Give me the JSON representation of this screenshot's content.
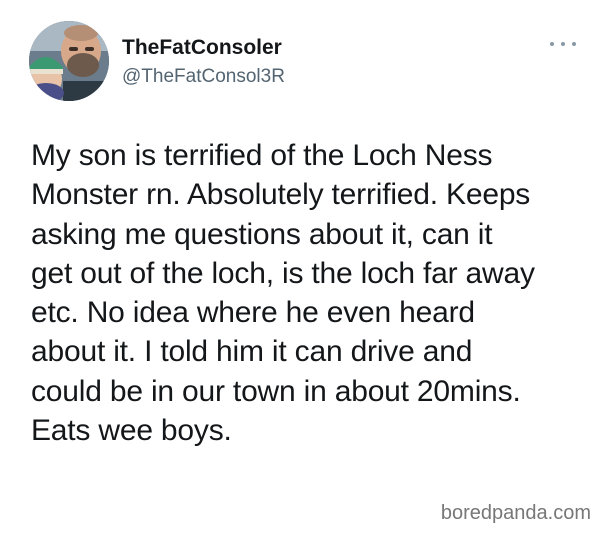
{
  "author": {
    "display_name": "TheFatConsoler",
    "handle": "@TheFatConsol3R",
    "avatar_icon": "profile-photo"
  },
  "more_icon": "more-options-icon",
  "tweet": {
    "lines": [
      "My son is terrified of the Loch Ness",
      "Monster rn. Absolutely terrified. Keeps",
      "asking me questions about it, can it",
      "get out of the loch, is the loch far away",
      "etc. No idea where he even heard",
      "about it. I told him it can drive and",
      "could be in our town in about 20mins.",
      "Eats wee boys."
    ]
  },
  "watermark": "boredpanda.com",
  "colors": {
    "text": "#14171a",
    "secondary": "#536471",
    "background": "#ffffff"
  }
}
